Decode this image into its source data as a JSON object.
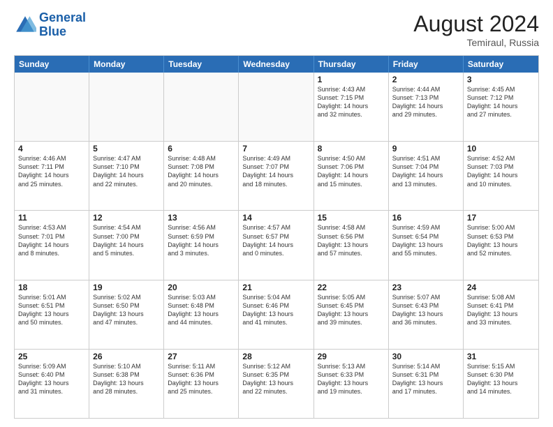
{
  "logo": {
    "line1": "General",
    "line2": "Blue"
  },
  "title": "August 2024",
  "location": "Temiraul, Russia",
  "days": [
    "Sunday",
    "Monday",
    "Tuesday",
    "Wednesday",
    "Thursday",
    "Friday",
    "Saturday"
  ],
  "rows": [
    [
      {
        "day": "",
        "text": "",
        "empty": true
      },
      {
        "day": "",
        "text": "",
        "empty": true
      },
      {
        "day": "",
        "text": "",
        "empty": true
      },
      {
        "day": "",
        "text": "",
        "empty": true
      },
      {
        "day": "1",
        "text": "Sunrise: 4:43 AM\nSunset: 7:15 PM\nDaylight: 14 hours\nand 32 minutes."
      },
      {
        "day": "2",
        "text": "Sunrise: 4:44 AM\nSunset: 7:13 PM\nDaylight: 14 hours\nand 29 minutes."
      },
      {
        "day": "3",
        "text": "Sunrise: 4:45 AM\nSunset: 7:12 PM\nDaylight: 14 hours\nand 27 minutes."
      }
    ],
    [
      {
        "day": "4",
        "text": "Sunrise: 4:46 AM\nSunset: 7:11 PM\nDaylight: 14 hours\nand 25 minutes."
      },
      {
        "day": "5",
        "text": "Sunrise: 4:47 AM\nSunset: 7:10 PM\nDaylight: 14 hours\nand 22 minutes."
      },
      {
        "day": "6",
        "text": "Sunrise: 4:48 AM\nSunset: 7:08 PM\nDaylight: 14 hours\nand 20 minutes."
      },
      {
        "day": "7",
        "text": "Sunrise: 4:49 AM\nSunset: 7:07 PM\nDaylight: 14 hours\nand 18 minutes."
      },
      {
        "day": "8",
        "text": "Sunrise: 4:50 AM\nSunset: 7:06 PM\nDaylight: 14 hours\nand 15 minutes."
      },
      {
        "day": "9",
        "text": "Sunrise: 4:51 AM\nSunset: 7:04 PM\nDaylight: 14 hours\nand 13 minutes."
      },
      {
        "day": "10",
        "text": "Sunrise: 4:52 AM\nSunset: 7:03 PM\nDaylight: 14 hours\nand 10 minutes."
      }
    ],
    [
      {
        "day": "11",
        "text": "Sunrise: 4:53 AM\nSunset: 7:01 PM\nDaylight: 14 hours\nand 8 minutes."
      },
      {
        "day": "12",
        "text": "Sunrise: 4:54 AM\nSunset: 7:00 PM\nDaylight: 14 hours\nand 5 minutes."
      },
      {
        "day": "13",
        "text": "Sunrise: 4:56 AM\nSunset: 6:59 PM\nDaylight: 14 hours\nand 3 minutes."
      },
      {
        "day": "14",
        "text": "Sunrise: 4:57 AM\nSunset: 6:57 PM\nDaylight: 14 hours\nand 0 minutes."
      },
      {
        "day": "15",
        "text": "Sunrise: 4:58 AM\nSunset: 6:56 PM\nDaylight: 13 hours\nand 57 minutes."
      },
      {
        "day": "16",
        "text": "Sunrise: 4:59 AM\nSunset: 6:54 PM\nDaylight: 13 hours\nand 55 minutes."
      },
      {
        "day": "17",
        "text": "Sunrise: 5:00 AM\nSunset: 6:53 PM\nDaylight: 13 hours\nand 52 minutes."
      }
    ],
    [
      {
        "day": "18",
        "text": "Sunrise: 5:01 AM\nSunset: 6:51 PM\nDaylight: 13 hours\nand 50 minutes."
      },
      {
        "day": "19",
        "text": "Sunrise: 5:02 AM\nSunset: 6:50 PM\nDaylight: 13 hours\nand 47 minutes."
      },
      {
        "day": "20",
        "text": "Sunrise: 5:03 AM\nSunset: 6:48 PM\nDaylight: 13 hours\nand 44 minutes."
      },
      {
        "day": "21",
        "text": "Sunrise: 5:04 AM\nSunset: 6:46 PM\nDaylight: 13 hours\nand 41 minutes."
      },
      {
        "day": "22",
        "text": "Sunrise: 5:05 AM\nSunset: 6:45 PM\nDaylight: 13 hours\nand 39 minutes."
      },
      {
        "day": "23",
        "text": "Sunrise: 5:07 AM\nSunset: 6:43 PM\nDaylight: 13 hours\nand 36 minutes."
      },
      {
        "day": "24",
        "text": "Sunrise: 5:08 AM\nSunset: 6:41 PM\nDaylight: 13 hours\nand 33 minutes."
      }
    ],
    [
      {
        "day": "25",
        "text": "Sunrise: 5:09 AM\nSunset: 6:40 PM\nDaylight: 13 hours\nand 31 minutes."
      },
      {
        "day": "26",
        "text": "Sunrise: 5:10 AM\nSunset: 6:38 PM\nDaylight: 13 hours\nand 28 minutes."
      },
      {
        "day": "27",
        "text": "Sunrise: 5:11 AM\nSunset: 6:36 PM\nDaylight: 13 hours\nand 25 minutes."
      },
      {
        "day": "28",
        "text": "Sunrise: 5:12 AM\nSunset: 6:35 PM\nDaylight: 13 hours\nand 22 minutes."
      },
      {
        "day": "29",
        "text": "Sunrise: 5:13 AM\nSunset: 6:33 PM\nDaylight: 13 hours\nand 19 minutes."
      },
      {
        "day": "30",
        "text": "Sunrise: 5:14 AM\nSunset: 6:31 PM\nDaylight: 13 hours\nand 17 minutes."
      },
      {
        "day": "31",
        "text": "Sunrise: 5:15 AM\nSunset: 6:30 PM\nDaylight: 13 hours\nand 14 minutes."
      }
    ]
  ]
}
